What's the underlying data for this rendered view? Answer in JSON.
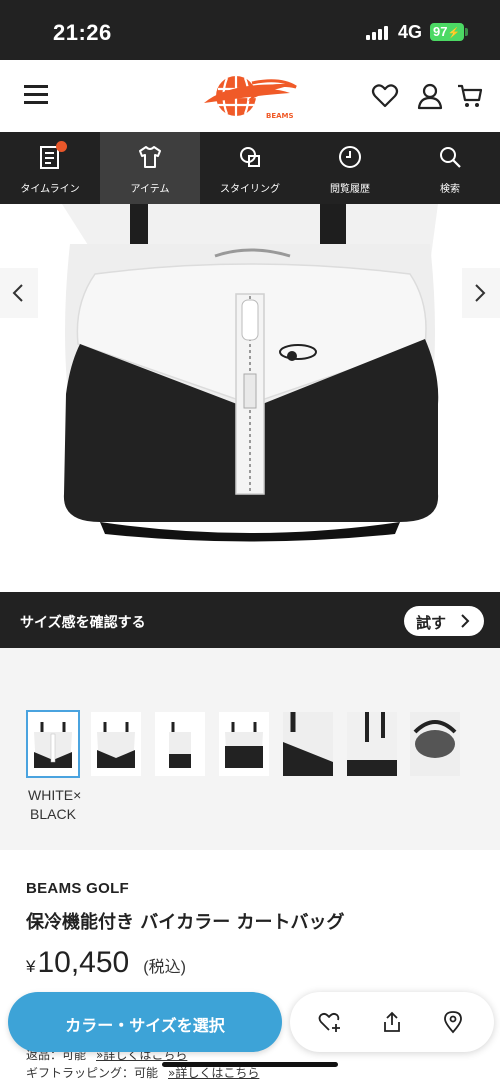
{
  "status_bar": {
    "time": "21:26",
    "network": "4G",
    "battery": "97"
  },
  "header": {
    "logo_text": "BEAMS",
    "brand_color": "#f05a28"
  },
  "nav": {
    "items": [
      {
        "label": "タイムライン",
        "icon": "timeline-icon"
      },
      {
        "label": "アイテム",
        "icon": "item-shirt-icon"
      },
      {
        "label": "スタイリング",
        "icon": "styling-icon"
      },
      {
        "label": "閲覧履歴",
        "icon": "history-clock-icon"
      },
      {
        "label": "検索",
        "icon": "search-icon"
      }
    ],
    "active_index": 1
  },
  "size_bar": {
    "text": "サイズ感を確認する",
    "button_label": "試す"
  },
  "color_options": {
    "selected_name_line1": "WHITE×",
    "selected_name_line2": "BLACK"
  },
  "product": {
    "brand": "BEAMS GOLF",
    "name": "保冷機能付き バイカラー カートバッグ",
    "currency": "¥",
    "price": "10,450",
    "tax_note": "(税込)"
  },
  "info_lines": [
    {
      "label": "返品：可能",
      "link": "»詳しくはこちら"
    },
    {
      "label": "ギフトラッピング：可能",
      "link": "»詳しくはこちら"
    }
  ],
  "actions": {
    "select_label": "カラー・サイズを選択",
    "accent_color": "#3da3d7"
  }
}
